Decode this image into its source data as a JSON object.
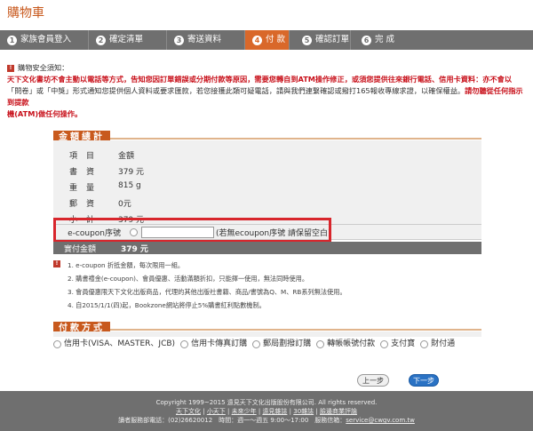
{
  "page": {
    "title": "購物車"
  },
  "steps": [
    {
      "num": "1",
      "label": "家族會員登入"
    },
    {
      "num": "2",
      "label": "確定清單"
    },
    {
      "num": "3",
      "label": "寄送資料"
    },
    {
      "num": "4",
      "label": "付 款"
    },
    {
      "num": "5",
      "label": "確認訂單"
    },
    {
      "num": "6",
      "label": "完 成"
    }
  ],
  "notice": {
    "title": "購物安全須知：",
    "line1_red": "天下文化書坊不會主動以電話等方式，告知您因訂單錯誤或分期付款等原因，需要您轉自到ATM操作修正",
    "line1_rest": "，或須您提供往來銀行電話、信用卡資料：亦不會以",
    "line2": "「問卷」或「中獎」形式通知您提供個人資料或要求匯款，若您接獲此類可疑電話，請與我們連繫確認或撥打165報收專線求證，以確保權益。",
    "line2_red": "請勿聽從任何指示到提款",
    "line3_red": "機(ATM)做任何操作。"
  },
  "amount": {
    "section_title": "金額總計",
    "header_key": "項目",
    "header_val": "金額",
    "rows": [
      {
        "k": "書資",
        "v": "379 元"
      },
      {
        "k": "重量",
        "v": "815 g"
      },
      {
        "k": "郵資",
        "v": "0元"
      },
      {
        "k": "小計",
        "v": "379 元"
      }
    ]
  },
  "ecoupon": {
    "label": "e-coupon序號",
    "value": "",
    "hint": "(若無ecoupon序號 請保留空白)"
  },
  "paid": {
    "label": "實付金額",
    "value": "379 元"
  },
  "notes": [
    "1. e-coupon 折抵金額，每次限用一組。",
    "2. 購書禮金(e-coupon)、會員優惠、活動滿額折扣，只能擇一使用，無法同時使用。",
    "3. 會員優惠限天下文化出版商品，代理的其他出版社書籍、商品/書號為Q、M、RB系列無法使用。",
    "4. 自2015/1/1(四)起，Bookzone網站將停止5%購書紅利點數機制。"
  ],
  "payment": {
    "section_title": "付款方式",
    "options": [
      "信用卡(VISA、MASTER、JCB)",
      "信用卡傳真訂購",
      "郵局劃撥訂購",
      "轉帳帳號付款",
      "支付寶",
      "財付通"
    ]
  },
  "buttons": {
    "prev": "上一步",
    "next": "下一步"
  },
  "footer": {
    "copyright": "Copyright 1999~2015 遠見天下文化出版股份有限公司. All rights reserved.",
    "links": [
      "天下文化",
      "小天下",
      "未來少年",
      "遠見雜誌",
      "30雜誌",
      "臉邊商業評論"
    ],
    "service_prefix": "讀者服務部電話：(02)26620012　時間：週一～週五 9:00～17:00　服務信箱：",
    "service_email": "service@cwgv.com.tw"
  },
  "colors": {
    "accent": "#c8591d",
    "step_bar": "#6f6f6f",
    "highlight": "#d8262c",
    "warn": "#c8101a",
    "next_button": "#2a72c4"
  }
}
